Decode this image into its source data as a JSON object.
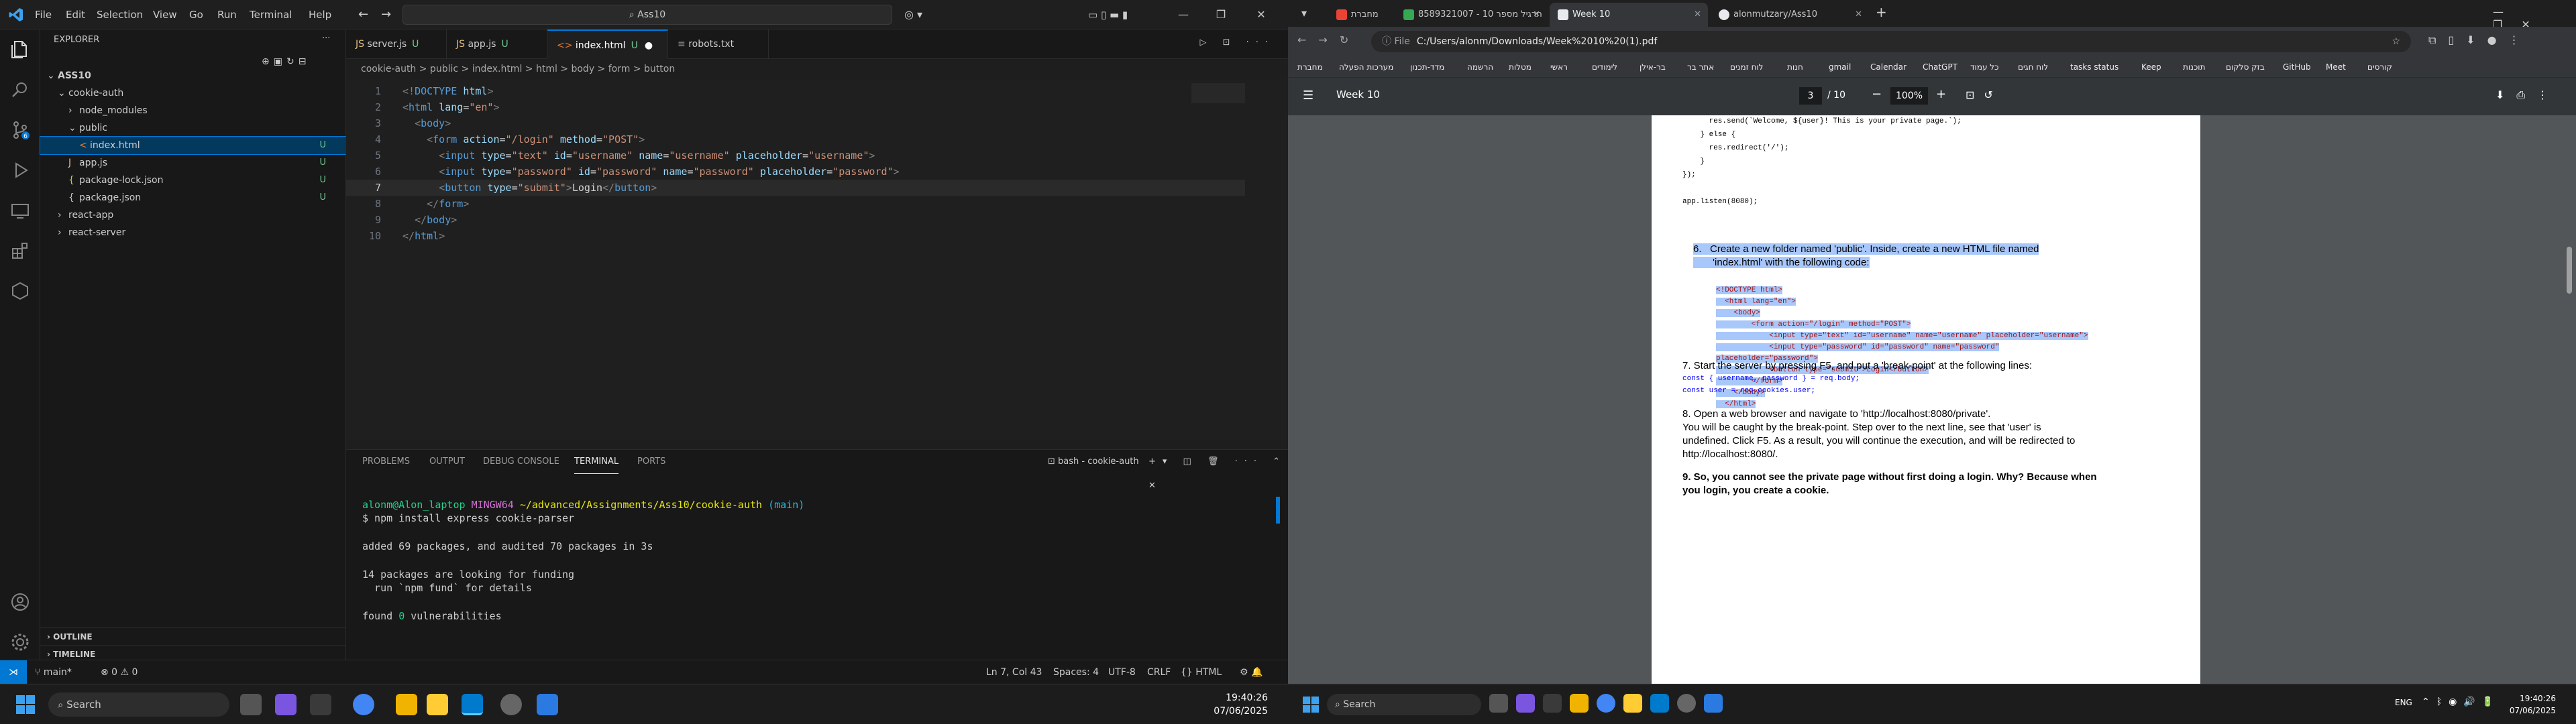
{
  "vscode": {
    "menu": [
      "File",
      "Edit",
      "Selection",
      "View",
      "Go",
      "Run",
      "Terminal",
      "Help"
    ],
    "search": "Ass10",
    "explorer_title": "EXPLORER",
    "tree": [
      {
        "label": "ASS10",
        "indent": 0,
        "arrow": "v",
        "status": ""
      },
      {
        "label": "cookie-auth",
        "indent": 1,
        "arrow": "v",
        "status": ""
      },
      {
        "label": "node_modules",
        "indent": 2,
        "arrow": ">",
        "status": ""
      },
      {
        "label": "public",
        "indent": 2,
        "arrow": "v",
        "status": ""
      },
      {
        "label": "index.html",
        "indent": 3,
        "arrow": "",
        "status": "U"
      },
      {
        "label": "app.js",
        "indent": 2,
        "arrow": "",
        "status": "U"
      },
      {
        "label": "package-lock.json",
        "indent": 2,
        "arrow": "",
        "status": "U"
      },
      {
        "label": "package.json",
        "indent": 2,
        "arrow": "",
        "status": "U"
      },
      {
        "label": "react-app",
        "indent": 1,
        "arrow": ">",
        "status": ""
      },
      {
        "label": "react-server",
        "indent": 1,
        "arrow": ">",
        "status": ""
      }
    ],
    "outline": "OUTLINE",
    "timeline": "TIMELINE",
    "tabs": [
      {
        "label": "server.js",
        "status": "U"
      },
      {
        "label": "app.js",
        "status": "U"
      },
      {
        "label": "index.html",
        "status": "U"
      },
      {
        "label": "robots.txt",
        "status": ""
      }
    ],
    "breadcrumb": "cookie-auth  >  public  >  index.html  >  html  >  body  >  form  >  button",
    "code_lines": [
      {
        "n": "1",
        "html": "<span class='t-pun'>&lt;!</span><span class='t-tag'>DOCTYPE</span> <span class='t-attr'>html</span><span class='t-pun'>&gt;</span>"
      },
      {
        "n": "2",
        "html": "<span class='t-pun'>&lt;</span><span class='t-tag'>html</span> <span class='t-attr'>lang</span>=<span class='t-str'>\"en\"</span><span class='t-pun'>&gt;</span>"
      },
      {
        "n": "3",
        "html": "  <span class='t-pun'>&lt;</span><span class='t-tag'>body</span><span class='t-pun'>&gt;</span>"
      },
      {
        "n": "4",
        "html": "    <span class='t-pun'>&lt;</span><span class='t-tag'>form</span> <span class='t-attr'>action</span>=<span class='t-str'>\"/login\"</span> <span class='t-attr'>method</span>=<span class='t-str'>\"POST\"</span><span class='t-pun'>&gt;</span>"
      },
      {
        "n": "5",
        "html": "      <span class='t-pun'>&lt;</span><span class='t-tag'>input</span> <span class='t-attr'>type</span>=<span class='t-str'>\"text\"</span> <span class='t-attr'>id</span>=<span class='t-str'>\"username\"</span> <span class='t-attr'>name</span>=<span class='t-str'>\"username\"</span> <span class='t-attr'>placeholder</span>=<span class='t-str'>\"username\"</span><span class='t-pun'>&gt;</span>"
      },
      {
        "n": "6",
        "html": "      <span class='t-pun'>&lt;</span><span class='t-tag'>input</span> <span class='t-attr'>type</span>=<span class='t-str'>\"password\"</span> <span class='t-attr'>id</span>=<span class='t-str'>\"password\"</span> <span class='t-attr'>name</span>=<span class='t-str'>\"password\"</span> <span class='t-attr'>placeholder</span>=<span class='t-str'>\"password\"</span><span class='t-pun'>&gt;</span>"
      },
      {
        "n": "7",
        "html": "      <span class='t-pun'>&lt;</span><span class='t-tag'>button</span> <span class='t-attr'>type</span>=<span class='t-str'>\"submit\"</span><span class='t-pun'>&gt;</span><span class='t-txt'>Login</span><span class='t-pun'>&lt;/</span><span class='t-tag'>button</span><span class='t-pun'>&gt;</span>"
      },
      {
        "n": "8",
        "html": "    <span class='t-pun'>&lt;/</span><span class='t-tag'>form</span><span class='t-pun'>&gt;</span>"
      },
      {
        "n": "9",
        "html": "  <span class='t-pun'>&lt;/</span><span class='t-tag'>body</span><span class='t-pun'>&gt;</span>"
      },
      {
        "n": "10",
        "html": "<span class='t-pun'>&lt;/</span><span class='t-tag'>html</span><span class='t-pun'>&gt;</span>"
      }
    ],
    "panel_tabs": [
      "PROBLEMS",
      "OUTPUT",
      "DEBUG CONSOLE",
      "TERMINAL",
      "PORTS"
    ],
    "terminal_name": "bash - cookie-auth",
    "terminal": {
      "prompt_user": "alonm@Alon_laptop",
      "prompt_env": "MINGW64",
      "prompt_path": "~/advanced/Assignments/Ass10/cookie-auth",
      "prompt_branch": "(main)",
      "command": "$ npm install express cookie-parser",
      "out1": "added 69 packages, and audited 70 packages in 3s",
      "out2": "14 packages are looking for funding",
      "out3": "  run `npm fund` for details",
      "out4a": "found",
      "out4b": "0",
      "out4c": "vulnerabilities"
    },
    "status": {
      "branch": "main*",
      "problems": "⊗ 0 ⚠ 0",
      "position": "Ln 7, Col 43",
      "spaces": "Spaces: 4",
      "encoding": "UTF-8",
      "eol": "CRLF",
      "lang": "HTML"
    }
  },
  "taskbar_left": {
    "search": "Search",
    "time": "19:40:26",
    "date": "07/06/2025"
  },
  "chrome": {
    "tabs": [
      {
        "label": "מחברת",
        "color": "#ea4335"
      },
      {
        "label": "תרגיל מספר 10 - 8589321007",
        "color": "#34a853"
      },
      {
        "label": "Week 10",
        "color": "#e8eaed"
      },
      {
        "label": "alonmutzary/Ass10",
        "color": "#e8eaed"
      }
    ],
    "url_prefix": "File",
    "url": "C:/Users/alonm/Downloads/Week%2010%20(1).pdf",
    "bookmarks": [
      "מחברת",
      "מערכות הפעלה",
      "מדד-תכנון",
      "הרשמה",
      "מטלות",
      "ראשי",
      "לימודים",
      "בר-אילן",
      "אתר בר",
      "לוח זמנים",
      "חנות",
      "gmail",
      "Calendar",
      "ChatGPT",
      "כל עמוד",
      "לוח חגים",
      "tasks status",
      "Keep",
      "תוכנות",
      "בזק סלקום",
      "GitHub",
      "Meet",
      "קורסים"
    ],
    "pdf": {
      "title": "Week 10",
      "page_current": "3",
      "page_total": "/ 10",
      "zoom": "100%",
      "code_top": [
        "      res.send(`Welcome, ${user}! This is your private page.`);",
        "    } else {",
        "      res.redirect('/');",
        "    }",
        "});",
        "",
        "app.listen(8080);"
      ],
      "step6a": "6.   Create a new folder named 'public'. Inside, create a new HTML file named",
      "step6b": "       'index.html' with the following code:",
      "html_code": [
        "<!DOCTYPE html>",
        "  <html lang=\"en\">",
        "    <body>",
        "        <form action=\"/login\" method=\"POST\">",
        "            <input type=\"text\" id=\"username\" name=\"username\" placeholder=\"username\">",
        "            <input type=\"password\" id=\"password\" name=\"password\"",
        "placeholder=\"password\">",
        "            <button type=\"submit\">Login</button>",
        "        </form>",
        "    </body>",
        "  </html>"
      ],
      "step7": "7. Start the server by pressing F5, and put a 'break-point' at the following lines:",
      "step7c1": "const { username, password } = req.body;",
      "step7c2": "const user = req.cookies.user;",
      "step8a": "8. Open a web browser and navigate to 'http://localhost:8080/private'.",
      "step8b": "You will be caught by the break-point. Step over to the next line, see that 'user' is",
      "step8c": "undefined. Click F5. As a result, you will continue the execution, and will be redirected to",
      "step8d": "http://localhost:8080/.",
      "step9a": "9. So, you cannot see the private page without first doing a login. Why? Because when",
      "step9b": "you login, you create a cookie."
    }
  },
  "taskbar_right": {
    "search": "Search",
    "lang": "ENG",
    "time": "19:40:26",
    "date": "07/06/2025"
  },
  "colors": {
    "vscode_accent": "#0078d4",
    "untracked": "#73c991",
    "pdf_highlight": "#a8c7fa"
  }
}
